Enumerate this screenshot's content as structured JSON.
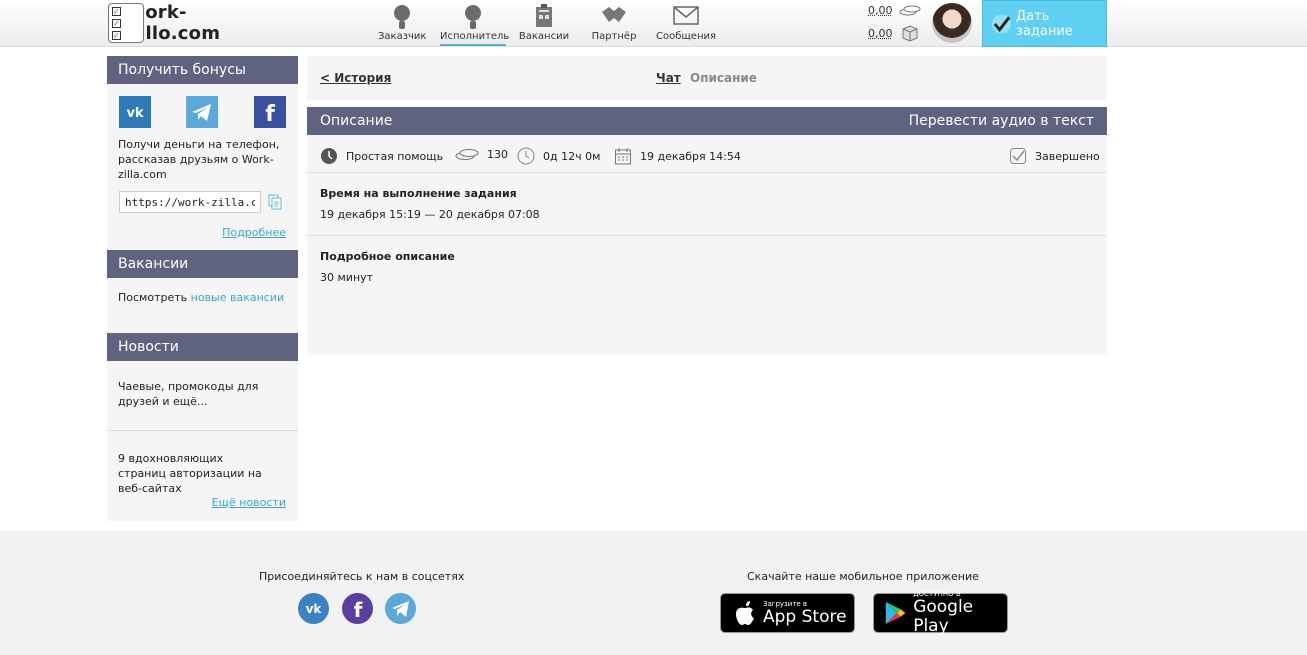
{
  "header": {
    "logo_text": "work-zillo.com",
    "nav": [
      {
        "label": "Заказчик",
        "icon": "customer-icon"
      },
      {
        "label": "Исполнитель",
        "icon": "performer-icon",
        "active": true
      },
      {
        "label": "Вакансии",
        "icon": "vacancies-icon"
      },
      {
        "label": "Партнёр",
        "icon": "partner-icon"
      },
      {
        "label": "Сообщения",
        "icon": "messages-icon"
      }
    ],
    "balance_coins": "0,00",
    "balance_box": "0,00",
    "give_task_label": "Дать задание"
  },
  "sidebar": {
    "bonus": {
      "title": "Получить бонусы",
      "text": "Получи деньги на телефон, рассказав друзьям о Work-zilla.com",
      "ref_link": "https://work-zilla.com/",
      "more_link": "Подробнее"
    },
    "vacancies": {
      "title": "Вакансии",
      "text": "Посмотреть",
      "link": "новые вакансии"
    },
    "news": {
      "title": "Новости",
      "items": [
        "Чаевые, промокоды для друзей и ещё...",
        "9 вдохновляющих страниц авторизации на веб-сайтах"
      ],
      "more_link": "Ещё новости"
    }
  },
  "main": {
    "back_link": "< История",
    "tab_chat": "Чат",
    "tab_description": "Описание",
    "heading_left": "Описание",
    "heading_right": "Перевести аудио в текст",
    "meta": {
      "category": "Простая помощь",
      "price": "130",
      "duration": "0д 12ч 0м",
      "date": "19 декабря 14:54",
      "status": "Завершено"
    },
    "time_section": {
      "title": "Время на выполнение задания",
      "value": "19 декабря 15:19 — 20 декабря 07:08"
    },
    "detail_section": {
      "title": "Подробное описание",
      "value": "30 минут"
    }
  },
  "footer": {
    "social_title": "Присоединяйтесь к нам в соцсетях",
    "app_title": "Скачайте наше мобильное приложение",
    "appstore_small": "Загрузите в",
    "appstore_big": "App Store",
    "gplay_small": "ДОСТУПНО В",
    "gplay_big": "Google Play"
  },
  "colors": {
    "header_bar": "#5f6380",
    "accent": "#5fd0f2",
    "link": "#3ea3cf"
  }
}
